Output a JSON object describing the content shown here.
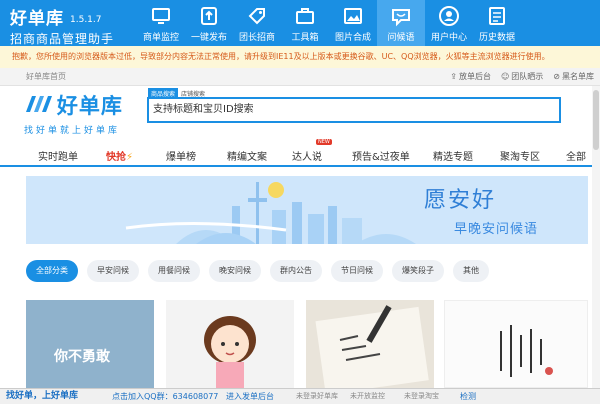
{
  "app": {
    "name": "好单库",
    "version": "1.5.1.7",
    "subtitle": "招商商品管理助手",
    "toolbar": [
      {
        "label": "商单监控",
        "icon": "monitor-icon"
      },
      {
        "label": "一键发布",
        "icon": "publish-icon"
      },
      {
        "label": "团长招商",
        "icon": "tag-icon"
      },
      {
        "label": "工具箱",
        "icon": "toolbox-icon"
      },
      {
        "label": "图片合成",
        "icon": "image-icon"
      },
      {
        "label": "问候语",
        "icon": "chat-icon"
      },
      {
        "label": "用户中心",
        "icon": "user-icon"
      },
      {
        "label": "历史数据",
        "icon": "history-icon"
      }
    ],
    "active_tool": "问候语",
    "accent": "#1a8fe3"
  },
  "notice": "抱歉，您所使用的浏览器版本过低，导致部分内容无法正常使用，请升级到IE11及以上版本或更换谷歌、UC、QQ浏览器，火狐等主流浏览器进行使用。",
  "strip": {
    "crumb": "好单库首页",
    "links": [
      "放单后台",
      "团队晒示",
      "黑名单库"
    ]
  },
  "site": {
    "logo_name": "好单库",
    "slogan": "找好单就上好单库",
    "search_tabs": [
      "商品搜索",
      "店铺搜索"
    ],
    "search_placeholder": "支持标题和宝贝ID搜索"
  },
  "nav": [
    {
      "label": "实时跑单"
    },
    {
      "label": "快抢",
      "hot": true
    },
    {
      "label": "爆单榜"
    },
    {
      "label": "精编文案"
    },
    {
      "label": "达人说",
      "badge": "NEW"
    },
    {
      "label": "预告&过夜单"
    },
    {
      "label": "精选专题"
    },
    {
      "label": "聚淘专区"
    },
    {
      "label": "全部"
    }
  ],
  "banner": {
    "title": "愿安好",
    "subtitle": "早晚安问候语"
  },
  "pills": [
    "全部分类",
    "早安问候",
    "用餐问候",
    "晚安问候",
    "群内公告",
    "节日问候",
    "爆笑段子",
    "其他"
  ],
  "cards": [
    {
      "text": "你不勇敢"
    },
    {
      "text": ""
    },
    {
      "text": ""
    },
    {
      "text": ""
    }
  ],
  "status": {
    "left": "找好单，上好单库",
    "qq": "点击加入QQ群：634608077",
    "login": "进入发单后台",
    "s1": "未登录好单库",
    "s2": "未开放监控",
    "s3": "未登录淘宝",
    "check": "检测"
  }
}
